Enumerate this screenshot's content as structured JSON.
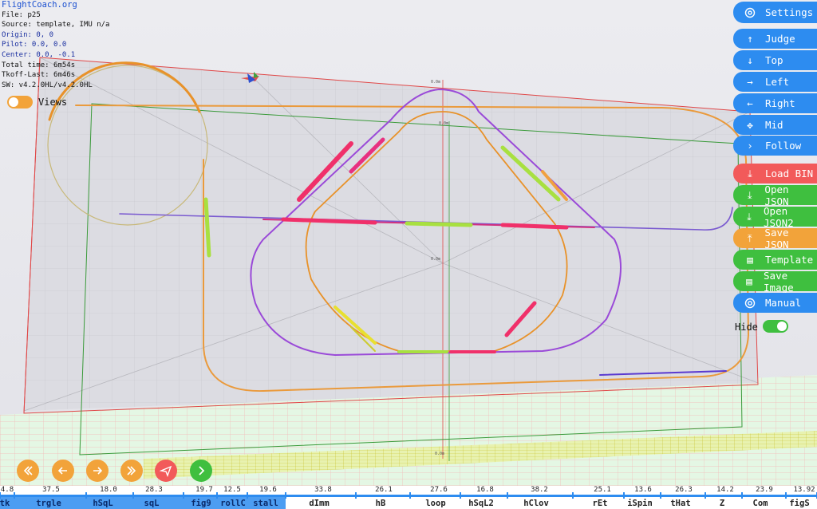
{
  "info": {
    "site": "FlightCoach.org",
    "file": "File: p25",
    "source": "Source: template, IMU n/a",
    "origin": "Origin: 0, 0",
    "pilot": "Pilot: 0.0, 0.0",
    "center": "Center: 0.0, -0.1",
    "total_time": "Total time: 6m54s",
    "tkoff_last": "Tkoff-Last: 6m46s",
    "sw": "SW: v4.2.0HL/v4.2.0HL"
  },
  "toggles": {
    "views_label": "Views",
    "hide_label": "Hide"
  },
  "buttons": {
    "settings": "Settings",
    "judge": "Judge",
    "top": "Top",
    "left": "Left",
    "right": "Right",
    "mid": "Mid",
    "follow": "Follow",
    "load_bin": "Load BIN",
    "open_json": "Open JSON",
    "open_json2": "Open JSON2",
    "save_json": "Save JSON",
    "template": "Template",
    "save_image": "Save Image",
    "manual": "Manual"
  },
  "colors": {
    "blue": "#2d8cf0",
    "red": "#f25a5a",
    "green": "#3fbf3f",
    "orange": "#f2a33a",
    "magenta": "#f04e6e"
  },
  "playback_icons": [
    "rewind-icon",
    "back-icon",
    "forward-icon",
    "fast-forward-icon",
    "send-icon",
    "play-icon"
  ],
  "timeline": {
    "numbers": [
      "4.8",
      "37.5",
      "18.0",
      "28.3",
      "19.7",
      "12.5",
      "19.6",
      "33.8",
      "26.1",
      "27.6",
      "16.8",
      "38.2",
      "25.1",
      "13.6",
      "26.3",
      "14.2",
      "23.9",
      "13.92"
    ],
    "manoeuvres": [
      "tk",
      "trgle",
      "hSqL",
      "sqL",
      "fig9",
      "rollC",
      "stall",
      "dImm",
      "hB",
      "loop",
      "hSqL2",
      "hClov",
      "rEt",
      "iSpin",
      "tHat",
      "Z",
      "Com",
      "figS"
    ],
    "highlighted_count": 7
  }
}
